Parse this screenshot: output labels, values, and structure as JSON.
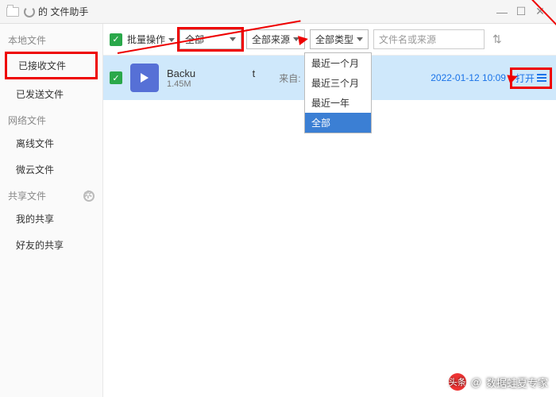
{
  "titlebar": {
    "title": "的 文件助手"
  },
  "sidebar": {
    "section_local": "本地文件",
    "item_received": "已接收文件",
    "item_sent": "已发送文件",
    "section_network": "网络文件",
    "item_offline": "离线文件",
    "item_weiyun": "微云文件",
    "section_shared": "共享文件",
    "item_myshare": "我的共享",
    "item_friendshare": "好友的共享"
  },
  "toolbar": {
    "batch_label": "批量操作",
    "filter_time": "全部",
    "filter_source": "全部来源",
    "filter_type": "全部类型",
    "search_placeholder": "文件名或来源"
  },
  "dropdown": {
    "items": [
      "最近一个月",
      "最近三个月",
      "最近一年",
      "全部"
    ],
    "selected": "全部"
  },
  "file": {
    "name_prefix": "Backu",
    "name_suffix": "t",
    "size_prefix": "1.45M",
    "from_label": "来自:",
    "date": "2022-01-12 10:09",
    "open_label": "打开"
  },
  "watermark": {
    "brand": "头条",
    "at": "@",
    "author": "数据蛙夏专家"
  }
}
